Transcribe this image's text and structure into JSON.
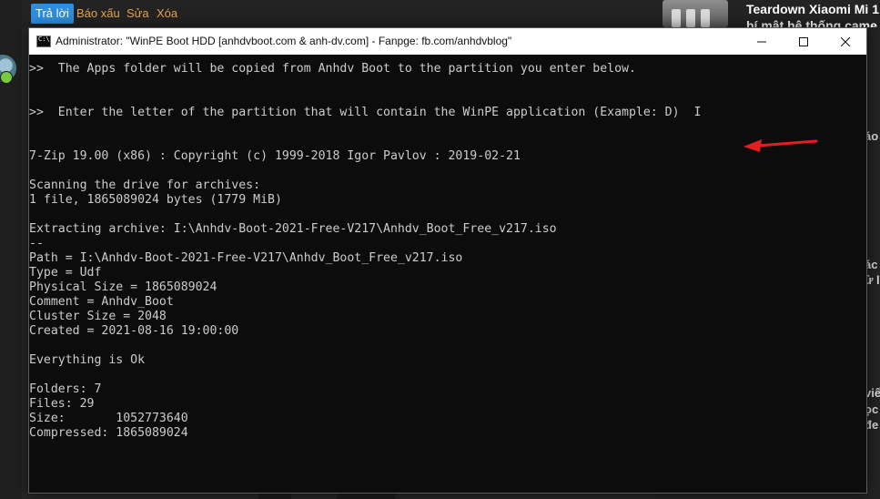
{
  "forum": {
    "actions": {
      "reply": "Trả lời",
      "report": "Báo xấu",
      "edit": "Sửa",
      "delete": "Xóa"
    }
  },
  "sidebar": {
    "article_title": "Teardown Xiaomi Mi 1",
    "article_subtitle": "bí mật hệ thống came",
    "fragments": [
      "áo",
      "ác",
      "ử li",
      "viế",
      "ọc",
      "đe"
    ]
  },
  "console": {
    "window_title": "Administrator:  \"WinPE Boot HDD [anhdvboot.com & anh-dv.com] -  Fanpge: fb.com/anhdvblog\"",
    "icon_glyph": "C:\\",
    "lines": [
      ">>  The Apps folder will be copied from Anhdv Boot to the partition you enter below.",
      "",
      "",
      ">>  Enter the letter of the partition that will contain the WinPE application (Example: D)  I",
      "",
      "",
      "7-Zip 19.00 (x86) : Copyright (c) 1999-2018 Igor Pavlov : 2019-02-21",
      "",
      "Scanning the drive for archives:",
      "1 file, 1865089024 bytes (1779 MiB)",
      "",
      "Extracting archive: I:\\Anhdv-Boot-2021-Free-V217\\Anhdv_Boot_Free_v217.iso",
      "--",
      "Path = I:\\Anhdv-Boot-2021-Free-V217\\Anhdv_Boot_Free_v217.iso",
      "Type = Udf",
      "Physical Size = 1865089024",
      "Comment = Anhdv_Boot",
      "Cluster Size = 2048",
      "Created = 2021-08-16 19:00:00",
      "",
      "Everything is Ok",
      "",
      "Folders: 7",
      "Files: 29",
      "Size:       1052773640",
      "Compressed: 1865089024"
    ]
  },
  "colors": {
    "accent_reply": "#2f8ee0",
    "action_text": "#e8a34a",
    "arrow": "#e02020",
    "console_bg": "#0c0c0c",
    "console_fg": "#cccccc"
  },
  "icons": [
    "minimize-icon",
    "maximize-icon",
    "close-icon",
    "red-arrow-annotation"
  ]
}
